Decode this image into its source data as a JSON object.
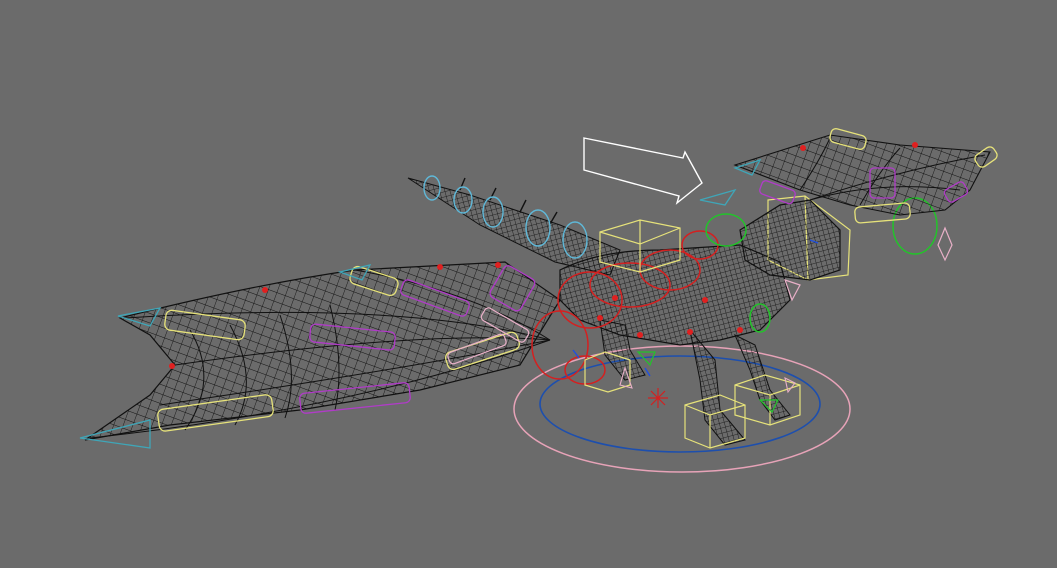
{
  "viewport": {
    "background": "#6b6b6b",
    "wire_color": "#111111"
  },
  "rig_colors": {
    "ik_handle": "#e6e27a",
    "joint_control": "#b03cc8",
    "spine_control": "#d42020",
    "head_control": "#22c42a",
    "tail_control": "#5fb8d8",
    "locator": "#e8b0c8",
    "root_outer": "#e7a3b8",
    "root_inner": "#1d4fae",
    "arrow": "#ffffff",
    "wing_tip": "#3fa6b8"
  },
  "icons": {
    "direction": "direction-arrow-icon"
  }
}
